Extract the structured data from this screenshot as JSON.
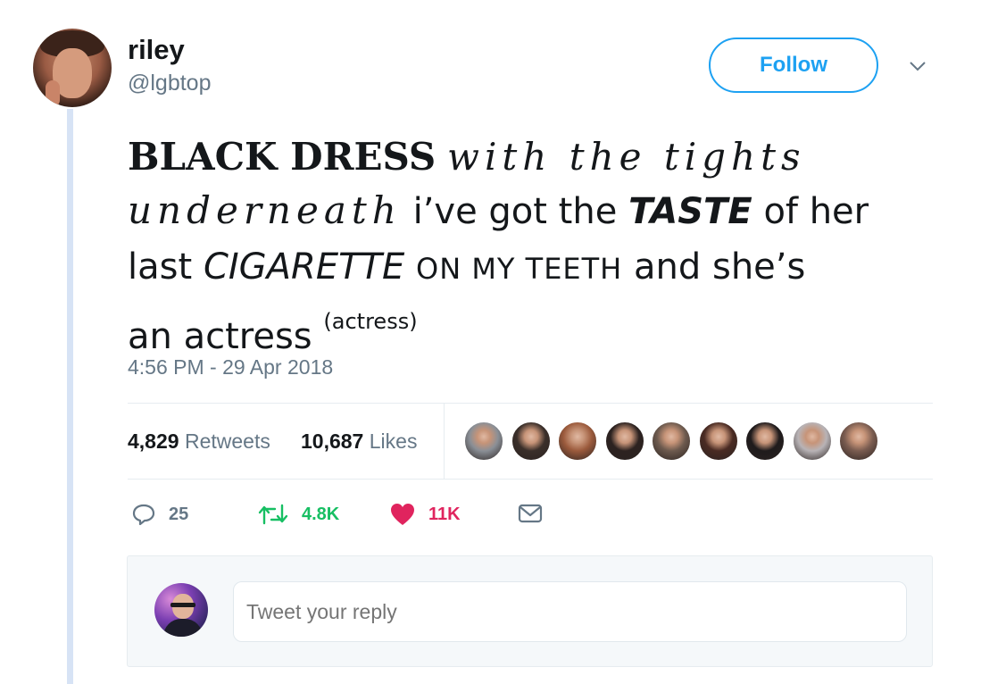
{
  "tweet": {
    "author": {
      "display_name": "riley",
      "handle": "@lgbtop"
    },
    "follow_label": "Follow",
    "text_segments": [
      "BLACK DRESS",
      "with the tights",
      "underneath",
      "i’ve got the",
      "TASTE",
      "of her",
      "last",
      "CIGARETTE",
      "ON MY TEETH",
      "and she’s",
      "an actress",
      "(actress)"
    ],
    "timestamp": "4:56 PM - 29 Apr 2018",
    "stats": {
      "retweets_count": "4,829",
      "retweets_label": "Retweets",
      "likes_count": "10,687",
      "likes_label": "Likes"
    },
    "likers": [
      {
        "icon": "liker-avatar",
        "color": "#8a8f96"
      },
      {
        "icon": "liker-avatar",
        "color": "#3a2f2a"
      },
      {
        "icon": "liker-avatar",
        "color": "#9b5a3c"
      },
      {
        "icon": "liker-avatar",
        "color": "#2c2220"
      },
      {
        "icon": "liker-avatar",
        "color": "#6d5a4e"
      },
      {
        "icon": "liker-avatar",
        "color": "#4a2b23"
      },
      {
        "icon": "liker-avatar",
        "color": "#1f1b1c"
      },
      {
        "icon": "liker-avatar",
        "color": "#b8b3b6"
      },
      {
        "icon": "liker-avatar",
        "color": "#7a5c50"
      }
    ],
    "actions": {
      "reply_count": "25",
      "retweet_count": "4.8K",
      "like_count": "11K"
    }
  },
  "reply_box": {
    "placeholder": "Tweet your reply"
  },
  "colors": {
    "accent": "#1da1f2",
    "retweet": "#17bf63",
    "like": "#e0245e",
    "muted": "#657786",
    "thread_line": "#d7e3f5"
  }
}
